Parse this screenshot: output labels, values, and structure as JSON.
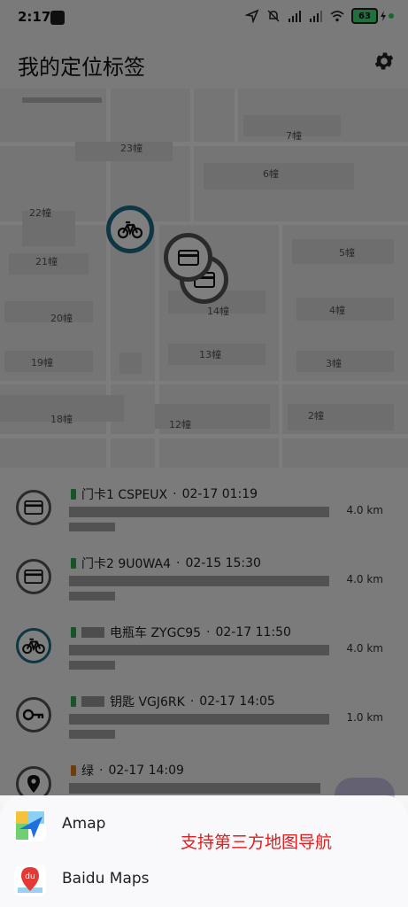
{
  "status_bar": {
    "time": "2:17",
    "battery": "63"
  },
  "header": {
    "title": "我的定位标签"
  },
  "map": {
    "building_labels": [
      "23幢",
      "7幢",
      "6幢",
      "22幢",
      "21幢",
      "5幢",
      "14幢",
      "4幢",
      "20幢",
      "13幢",
      "19幢",
      "3幢",
      "18幢",
      "12幢",
      "2幢"
    ]
  },
  "tags": [
    {
      "icon": "card-icon",
      "name": "门卡1 CSPEUX",
      "time": "02-17 01:19",
      "distance": "4.0 km",
      "battery_color": "#2fa84e"
    },
    {
      "icon": "card-icon",
      "name": "门卡2 9U0WA4",
      "time": "02-15 15:30",
      "distance": "4.0 km",
      "battery_color": "#2fa84e"
    },
    {
      "icon": "bike-icon",
      "name": "电瓶车 ZYGC95",
      "time": "02-17 11:50",
      "distance": "4.0 km",
      "battery_color": "#2fa84e"
    },
    {
      "icon": "key-icon",
      "name": "钥匙 VGJ6RK",
      "time": "02-17 14:05",
      "distance": "1.0 km",
      "battery_color": "#2fa84e"
    },
    {
      "icon": "location-pin-icon",
      "name": "绿",
      "time": "02-17 14:09",
      "distance": "",
      "battery_color": "#e07b18"
    }
  ],
  "separator": "·",
  "sheet": {
    "options": [
      {
        "label": "Amap"
      },
      {
        "label": "Baidu Maps"
      }
    ],
    "caption": "支持第三方地图导航",
    "baidu_icon_text": "du"
  }
}
